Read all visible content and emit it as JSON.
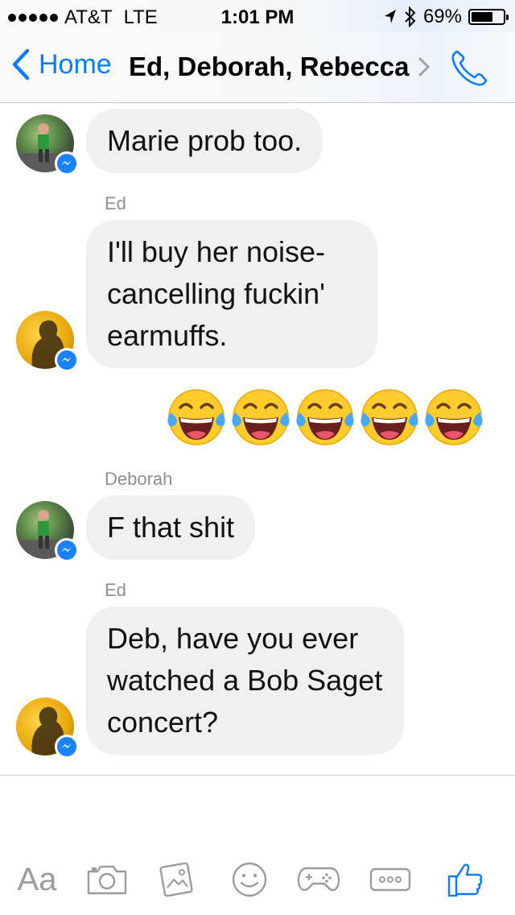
{
  "status_bar": {
    "carrier": "AT&T",
    "network": "LTE",
    "time": "1:01 PM",
    "battery_text": "69%",
    "battery_level": 0.69,
    "icons": [
      "location-arrow-icon",
      "bluetooth-icon",
      "battery-icon"
    ]
  },
  "nav": {
    "back_label": "Home",
    "title": "Ed, Deborah, Rebecca",
    "icons": [
      "back-chevron-icon",
      "chevron-right-icon",
      "phone-icon"
    ]
  },
  "messages": [
    {
      "sender_label": "",
      "text": "Marie prob too."
    },
    {
      "sender_label": "Ed",
      "text": "I'll buy her noise-cancelling fuckin' earmuffs."
    },
    {
      "sender_label": "",
      "emoji_count": 5,
      "emoji": "face-with-tears-of-joy"
    },
    {
      "sender_label": "Deborah",
      "text": "F that shit"
    },
    {
      "sender_label": "Ed",
      "text": "Deb, have you ever watched a Bob Saget concert?"
    }
  ],
  "toolbar": {
    "text_label": "Aa",
    "icons": [
      "camera-icon",
      "gallery-icon",
      "smiley-icon",
      "game-controller-icon",
      "more-icon",
      "thumbs-up-icon"
    ]
  },
  "colors": {
    "accent": "#0a7cff",
    "bubble": "#f1f0f0",
    "badge": "#1a82ff",
    "muted": "#8e8e93"
  }
}
